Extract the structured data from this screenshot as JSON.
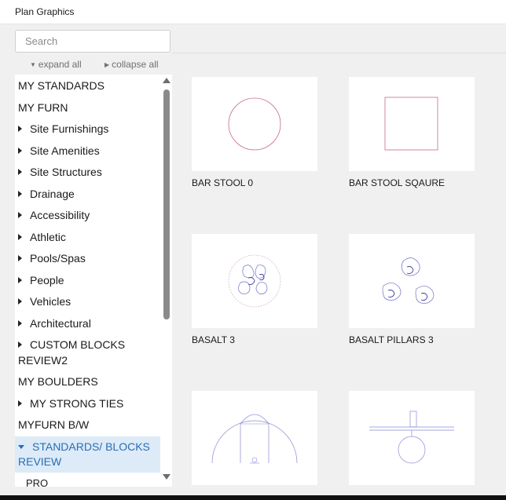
{
  "window": {
    "title": "Plan Graphics"
  },
  "search": {
    "placeholder": "Search"
  },
  "toolbar": {
    "expand_all": "expand all",
    "collapse_all": "collapse all"
  },
  "tree": {
    "items": [
      {
        "label": "MY STANDARDS",
        "expandable": false
      },
      {
        "label": "MY FURN",
        "expandable": false
      },
      {
        "label": "Site Furnishings",
        "expandable": true
      },
      {
        "label": "Site Amenities",
        "expandable": true
      },
      {
        "label": "Site Structures",
        "expandable": true
      },
      {
        "label": "Drainage",
        "expandable": true
      },
      {
        "label": "Accessibility",
        "expandable": true
      },
      {
        "label": "Athletic",
        "expandable": true
      },
      {
        "label": "Pools/Spas",
        "expandable": true
      },
      {
        "label": "People",
        "expandable": true
      },
      {
        "label": "Vehicles",
        "expandable": true
      },
      {
        "label": "Architectural",
        "expandable": true
      },
      {
        "label": "CUSTOM BLOCKS REVIEW2",
        "expandable": true
      },
      {
        "label": "MY BOULDERS",
        "expandable": false
      },
      {
        "label": "MY STRONG TIES",
        "expandable": true
      },
      {
        "label": "MYFURN B/W",
        "expandable": false
      }
    ],
    "selected": {
      "label": "STANDARDS/ BLOCKS REVIEW",
      "expanded": true
    },
    "partial_item": "PRO"
  },
  "gallery": {
    "cards": [
      {
        "label": "BAR STOOL 0",
        "icon": "circle-outline"
      },
      {
        "label": "BAR STOOL SQAURE",
        "icon": "square-outline"
      },
      {
        "label": "BASALT 3",
        "icon": "basalt-cluster"
      },
      {
        "label": "BASALT PILLARS 3",
        "icon": "basalt-pillars"
      },
      {
        "label": "",
        "icon": "arch-court"
      },
      {
        "label": "",
        "icon": "tee-circle"
      }
    ]
  },
  "colors": {
    "accent": "#2a6db5",
    "selected_bg": "#dcebf7",
    "symbol_line": "#c96a8a",
    "symbol_blue": "#6e6ec8"
  }
}
